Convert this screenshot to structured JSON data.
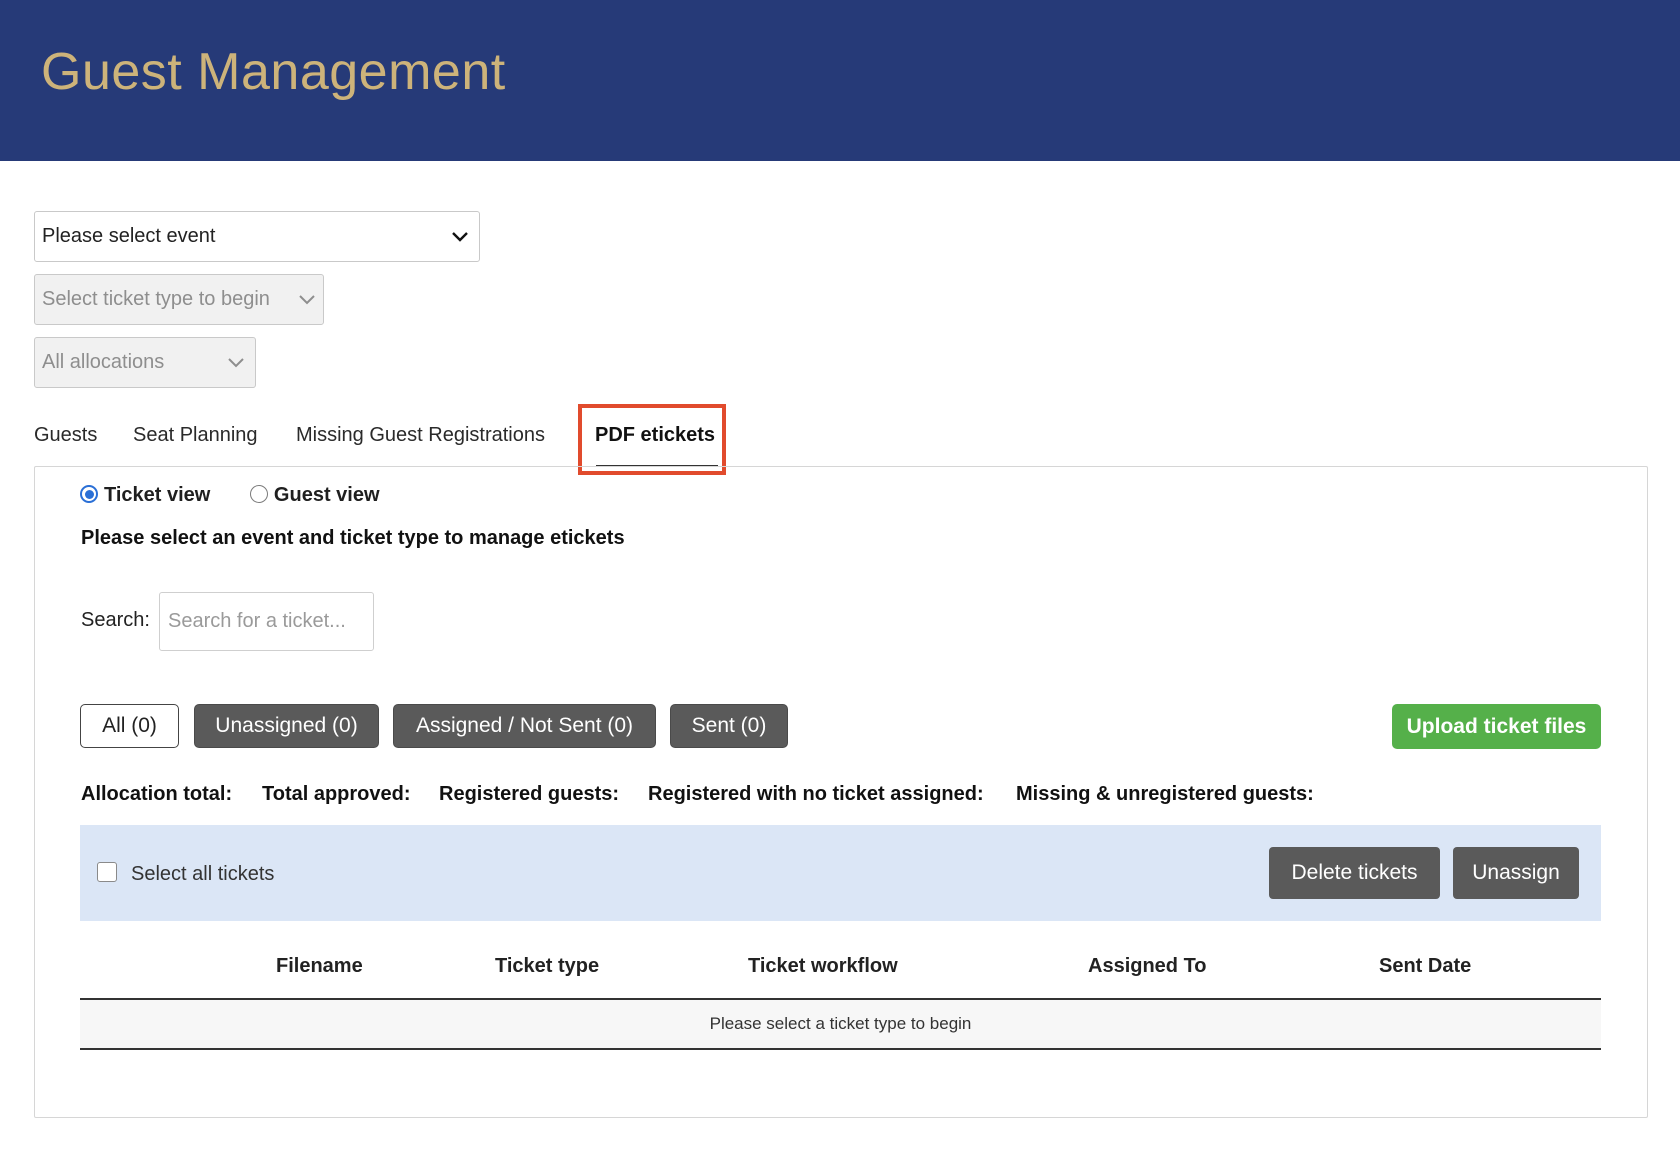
{
  "header": {
    "title": "Guest Management"
  },
  "filters": {
    "event_select": "Please select event",
    "ticket_type_select": "Select ticket type to begin",
    "allocations_select": "All allocations"
  },
  "tabs": [
    {
      "label": "Guests"
    },
    {
      "label": "Seat Planning"
    },
    {
      "label": "Missing Guest Registrations"
    },
    {
      "label": "PDF etickets",
      "active": true
    }
  ],
  "view_toggle": {
    "ticket_view": "Ticket view",
    "guest_view": "Guest view",
    "selected": "Ticket view"
  },
  "instructions": "Please select an event and ticket type to manage etickets",
  "search": {
    "label": "Search:",
    "placeholder": "Search for a ticket..."
  },
  "status_filters": [
    {
      "label": "All (0)",
      "style": "outline"
    },
    {
      "label": "Unassigned (0)",
      "style": "dark"
    },
    {
      "label": "Assigned / Not Sent (0)",
      "style": "dark"
    },
    {
      "label": "Sent (0)",
      "style": "dark"
    }
  ],
  "upload_button": "Upload ticket files",
  "stats": {
    "allocation_total": "Allocation total:",
    "total_approved": "Total approved:",
    "registered_guests": "Registered guests:",
    "registered_no_ticket": "Registered with no ticket assigned:",
    "missing_unregistered": "Missing & unregistered guests:"
  },
  "toolbar": {
    "select_all_label": "Select all tickets",
    "delete_label": "Delete tickets",
    "unassign_label": "Unassign"
  },
  "table": {
    "columns": [
      "Filename",
      "Ticket type",
      "Ticket workflow",
      "Assigned To",
      "Sent Date"
    ],
    "empty_message": "Please select a ticket type to begin"
  },
  "colors": {
    "header_bg": "#263a78",
    "title_gold": "#cdb37a",
    "upload_green": "#55b04a",
    "highlight_red": "#e14b2d",
    "toolbar_blue": "#dbe6f6",
    "dark_button": "#5a5a5a"
  }
}
